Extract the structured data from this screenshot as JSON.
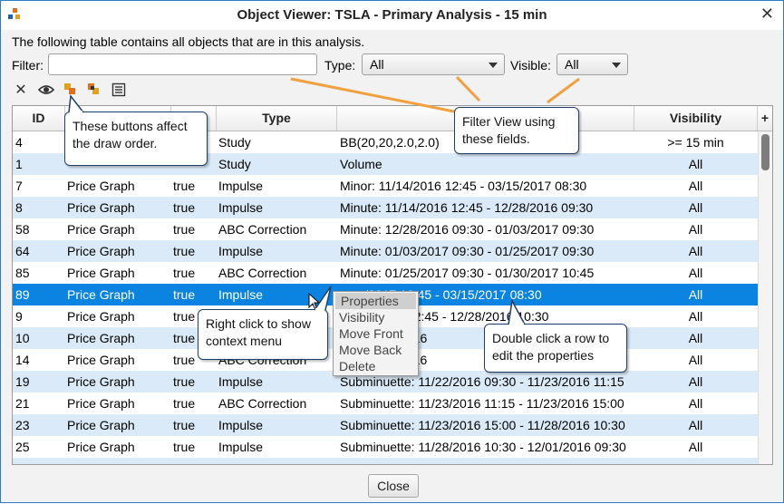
{
  "window": {
    "title": "Object Viewer: TSLA - Primary Analysis - 15 min",
    "close_glyph": "✕"
  },
  "description": "The following table contains all objects that are in this analysis.",
  "filter": {
    "label": "Filter:",
    "value": "",
    "type_label": "Type:",
    "type_value": "All",
    "visible_label": "Visible:",
    "visible_value": "All"
  },
  "toolbar": {
    "icons": [
      "close-icon",
      "eye-icon",
      "move-back-icon",
      "move-front-icon",
      "columns-icon"
    ],
    "clear_glyph": "✕"
  },
  "table": {
    "columns": [
      "ID",
      "",
      "",
      "Type",
      "D",
      "Visibility"
    ],
    "add_column_glyph": "+",
    "rows": [
      {
        "id": "4",
        "owner": "",
        "visible": "",
        "type": "Study",
        "desc": "BB(20,20,2.0,2.0)",
        "visibility": ">= 15 min"
      },
      {
        "id": "1",
        "owner": "",
        "visible": "",
        "type": "Study",
        "desc": "Volume",
        "visibility": "All"
      },
      {
        "id": "7",
        "owner": "Price Graph",
        "visible": "true",
        "type": "Impulse",
        "desc": "Minor: 11/14/2016 12:45 - 03/15/2017 08:30",
        "visibility": "All"
      },
      {
        "id": "8",
        "owner": "Price Graph",
        "visible": "true",
        "type": "Impulse",
        "desc": "Minute: 11/14/2016 12:45 - 12/28/2016 09:30",
        "visibility": "All"
      },
      {
        "id": "58",
        "owner": "Price Graph",
        "visible": "true",
        "type": "ABC Correction",
        "desc": "Minute: 12/28/2016 09:30 - 01/03/2017 09:30",
        "visibility": "All"
      },
      {
        "id": "64",
        "owner": "Price Graph",
        "visible": "true",
        "type": "Impulse",
        "desc": "Minute: 01/03/2017 09:30 - 01/25/2017 09:30",
        "visibility": "All"
      },
      {
        "id": "85",
        "owner": "Price Graph",
        "visible": "true",
        "type": "ABC Correction",
        "desc": "Minute: 01/25/2017 09:30 - 01/30/2017 10:45",
        "visibility": "All"
      },
      {
        "id": "89",
        "owner": "Price Graph",
        "visible": "true",
        "type": "Impulse",
        "desc": "       /2017 10:45 - 03/15/2017 08:30",
        "visibility": "All"
      },
      {
        "id": "9",
        "owner": "Price Graph",
        "visible": "true",
        "type": "",
        "desc": "       4/2016 12:45 - 12/28/2016 10:30",
        "visibility": "All"
      },
      {
        "id": "10",
        "owner": "Price Graph",
        "visible": "true",
        "type": "",
        "desc": "       11/14/2016",
        "visibility": "All"
      },
      {
        "id": "14",
        "owner": "Price Graph",
        "visible": "true",
        "type": "ABC Correction",
        "desc": "       11/18/2016",
        "visibility": "All"
      },
      {
        "id": "19",
        "owner": "Price Graph",
        "visible": "true",
        "type": "Impulse",
        "desc": "Subminuette: 11/22/2016 09:30 - 11/23/2016 11:15",
        "visibility": "All"
      },
      {
        "id": "21",
        "owner": "Price Graph",
        "visible": "true",
        "type": "ABC Correction",
        "desc": "Subminuette: 11/23/2016 11:15 - 11/23/2016 15:00",
        "visibility": "All"
      },
      {
        "id": "23",
        "owner": "Price Graph",
        "visible": "true",
        "type": "Impulse",
        "desc": "Subminuette: 11/23/2016 15:00 - 11/28/2016 10:30",
        "visibility": "All"
      },
      {
        "id": "25",
        "owner": "Price Graph",
        "visible": "true",
        "type": "Impulse",
        "desc": "Subminuette: 11/28/2016 10:30 - 12/01/2016 09:30",
        "visibility": "All"
      },
      {
        "id": "",
        "owner": "",
        "visible": "",
        "type": "",
        "desc": "",
        "visibility": ""
      }
    ],
    "selected_row_index": 7
  },
  "context_menu": {
    "items": [
      "Properties",
      "Visibility",
      "Move Front",
      "Move Back",
      "Delete"
    ],
    "highlighted_index": 0
  },
  "callouts": {
    "draw_order": "These buttons affect the draw order.",
    "filter_view": "Filter View using these fields.",
    "right_click": "Right click to show context menu",
    "double_click": "Double click a row to edit the properties"
  },
  "footer": {
    "close_label": "Close"
  },
  "colors": {
    "selection": "#0a84e0",
    "alt_row": "#dbeaf8",
    "callout_border": "#1f3f66",
    "arrow_orange": "#f0a040"
  }
}
